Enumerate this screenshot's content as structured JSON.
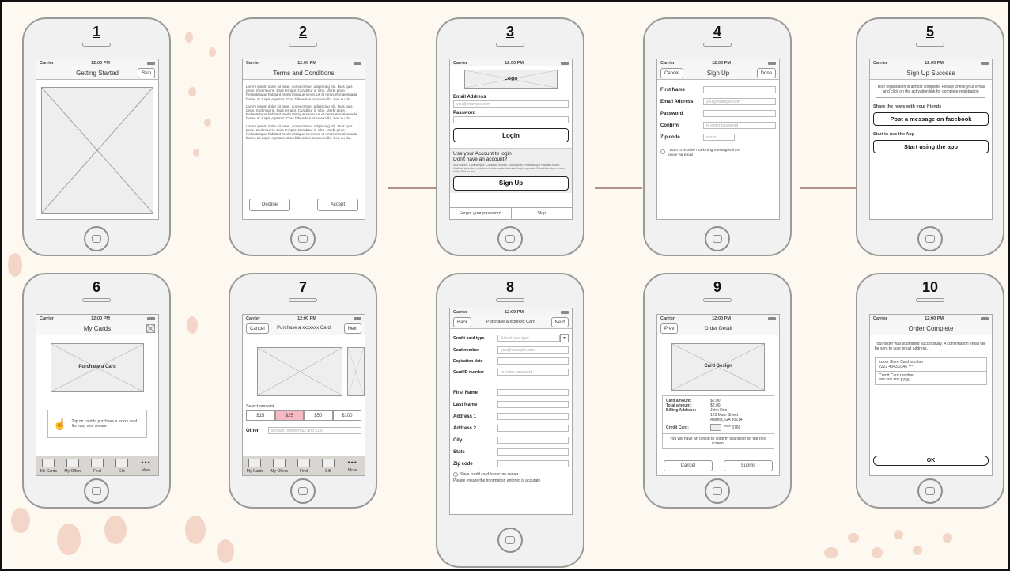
{
  "phones": [
    {
      "num": "1",
      "carrier": "Carrier",
      "time": "12:00 PM",
      "title": "Getting Started",
      "skip": "Skip"
    },
    {
      "num": "2",
      "carrier": "Carrier",
      "time": "12:00 PM",
      "title": "Terms and Conditions",
      "para": "Lorem ipsum dolor sit amet, consectetuer adipiscing elit. Duis quis pede. Sed mauris. Duis tempor. Curabitur in nibh. Morbi pede. Pellentesque habitant morbi tristique senectus et netus et malesuada fames ac turpis egestas. Cras bibendum ornare nulla. Sed eu dui.",
      "decline": "Decline",
      "accept": "Accept"
    },
    {
      "num": "3",
      "carrier": "Carrier",
      "time": "12:00 PM",
      "logo": "Logo",
      "email_label": "Email Address",
      "email_placeholder": "you@example.com",
      "password_label": "Password",
      "login": "Login",
      "account_line1": "Use your Account to login",
      "account_line2": "Don't have an account?",
      "small_text": "Sed mauris. Duis tempor. Curabitur in nibh. Morbi pede. Pellentesque habitant morbi tristique senectus et netus et malesuada fames ac turpis egestas. Cras bibendum ornare nulla. Sed eu dui.",
      "signup": "Sign Up",
      "forgot": "Forgot your password",
      "skip": "Skip"
    },
    {
      "num": "4",
      "carrier": "Carrier",
      "time": "12:00 PM",
      "cancel": "Cancel",
      "title": "Sign Up",
      "done": "Done",
      "first_name": "First Name",
      "email_label": "Email Address",
      "email_placeholder": "you@example.com",
      "password_label": "Password",
      "confirm_label": "Confirm",
      "confirm_placeholder": "re-enter password",
      "zip_label": "Zip code",
      "zip_placeholder": "xxxxx",
      "marketing": "I want to receive marketing messages from xxxxx via email"
    },
    {
      "num": "5",
      "carrier": "Carrier",
      "time": "12:00 PM",
      "title": "Sign Up Success",
      "message": "Your registration is almost complete. Please check your email and click on the activation link for complete registration",
      "share_label": "Share the news with your friends",
      "facebook": "Post a message on facebook",
      "start_label": "Start to use the App",
      "start": "Start using the app"
    },
    {
      "num": "6",
      "carrier": "Carrier",
      "time": "12:00 PM",
      "title": "My Cards",
      "purchase": "Purchase a Card",
      "tip": "Tap on card to purchase a xxxxx card.  It's easy and secure"
    },
    {
      "num": "7",
      "carrier": "Carrier",
      "time": "12:00 PM",
      "cancel": "Cancel",
      "title": "Purchase a xxxxxxx Card",
      "next": "Next",
      "select_amount": "Select amount",
      "amounts": [
        "$15",
        "$25",
        "$50",
        "$100"
      ],
      "selected_amount": "$25",
      "other_label": "Other",
      "other_placeholder": "amount between $2 and $100"
    },
    {
      "num": "8",
      "carrier": "Carrier",
      "time": "12:00 PM",
      "back": "Back",
      "title": "Purchase a xxxxxxx Card",
      "next": "Next",
      "card_type": "Credit card type",
      "card_type_placeholder": "Select card type",
      "card_number": "Card number",
      "card_number_placeholder": "you@example.com",
      "expiration": "Expiration date",
      "card_id": "Card ID number",
      "card_id_placeholder": "re-enter password",
      "first_name": "First Name",
      "last_name": "Last Name",
      "address1": "Address 1",
      "address2": "Address 2",
      "city": "City",
      "state": "State",
      "zip": "Zip code",
      "save_card": "Save credit card to secure server",
      "ensure": "Please ensure the information entered is accurate"
    },
    {
      "num": "9",
      "carrier": "Carrier",
      "time": "12:00 PM",
      "prev": "Prev",
      "title": "Order Detail",
      "card_design": "Card Design",
      "card_amount_label": "Card amount:",
      "card_amount": "$2.00",
      "total_label": "Total amount:",
      "total": "$2.00",
      "billing_label": "Billing Address:",
      "billing_name": "John Doe",
      "billing_street": "123 Main Street",
      "billing_city": "Atlanta, GA 30214",
      "credit_card_label": "Credit Card:",
      "credit_card": "**** 8766",
      "confirm_note": "You will have an option to confirm this order on the next screen.",
      "cancel": "Cancel",
      "submit": "Submit"
    },
    {
      "num": "10",
      "carrier": "Carrier",
      "time": "12:00 PM",
      "title": "Order Complete",
      "message": "Your order was submitted successfully.  A confirmation email will be sent to your email address.",
      "store_label": "xxxxx Store Card number",
      "store_number": "2222 4343 2345 ****",
      "credit_label": "Credit Card number",
      "credit_number": "**** **** **** 8766",
      "ok": "OK"
    }
  ],
  "tabs": [
    "My Cards",
    "My Offers",
    "Find",
    "Gift",
    "More"
  ],
  "colors": {
    "background": "#fdf9f1",
    "dot": "#f4d6c8",
    "connector": "#b09088",
    "selected_amount": "#f6b8c2"
  }
}
